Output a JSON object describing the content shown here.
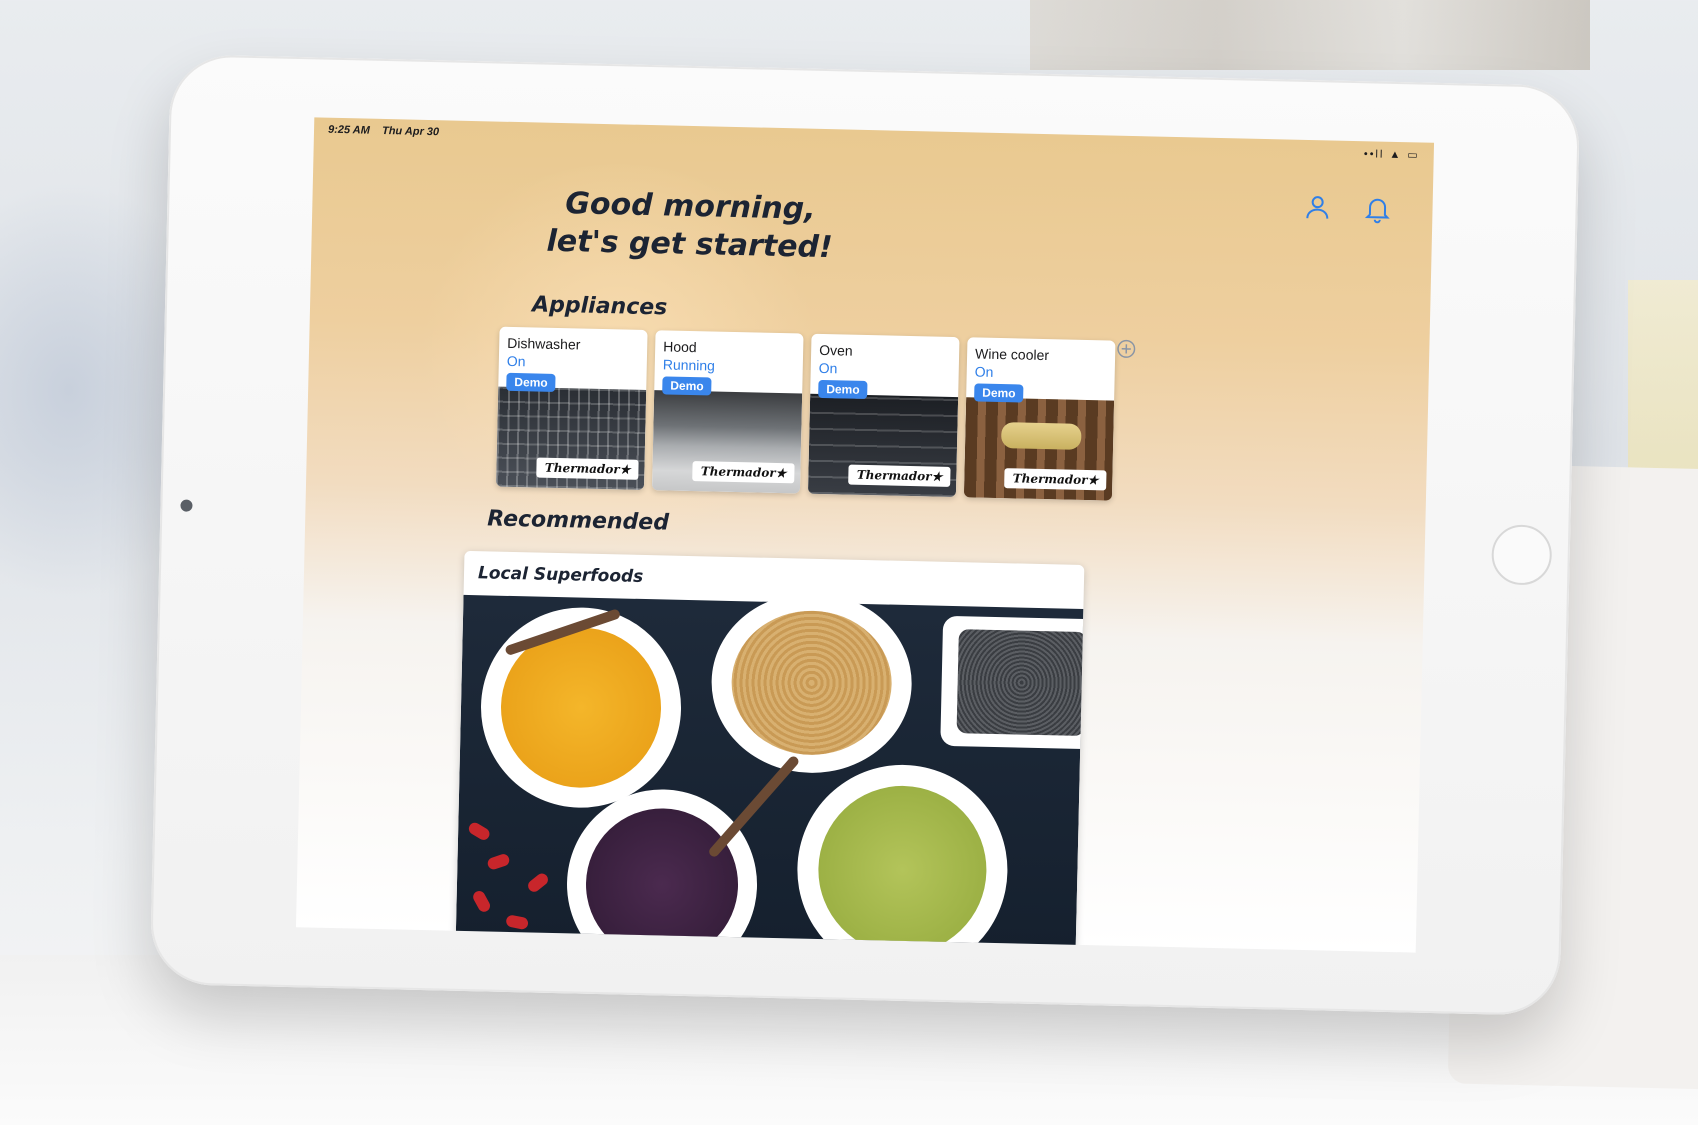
{
  "status_bar": {
    "time": "9:25 AM",
    "date": "Thu Apr 30",
    "indicators": "••ll  ▲  ▭"
  },
  "header": {
    "greeting_line1": "Good morning,",
    "greeting_line2": "let's get started!",
    "actions": [
      {
        "name": "profile-icon"
      },
      {
        "name": "bell-icon"
      }
    ]
  },
  "appliances": {
    "title": "Appliances",
    "add_icon": "plus-circle-icon",
    "items": [
      {
        "name": "Dishwasher",
        "status": "On",
        "badge": "Demo",
        "brand": "Thermador★"
      },
      {
        "name": "Hood",
        "status": "Running",
        "badge": "Demo",
        "brand": "Thermador★"
      },
      {
        "name": "Oven",
        "status": "On",
        "badge": "Demo",
        "brand": "Thermador★"
      },
      {
        "name": "Wine cooler",
        "status": "On",
        "badge": "Demo",
        "brand": "Thermador★"
      }
    ]
  },
  "recommended": {
    "title": "Recommended",
    "card_title": "Local Superfoods"
  },
  "colors": {
    "accent": "#2f7fe8",
    "demo_badge": "#3a86ec",
    "heading": "#1c2433"
  }
}
